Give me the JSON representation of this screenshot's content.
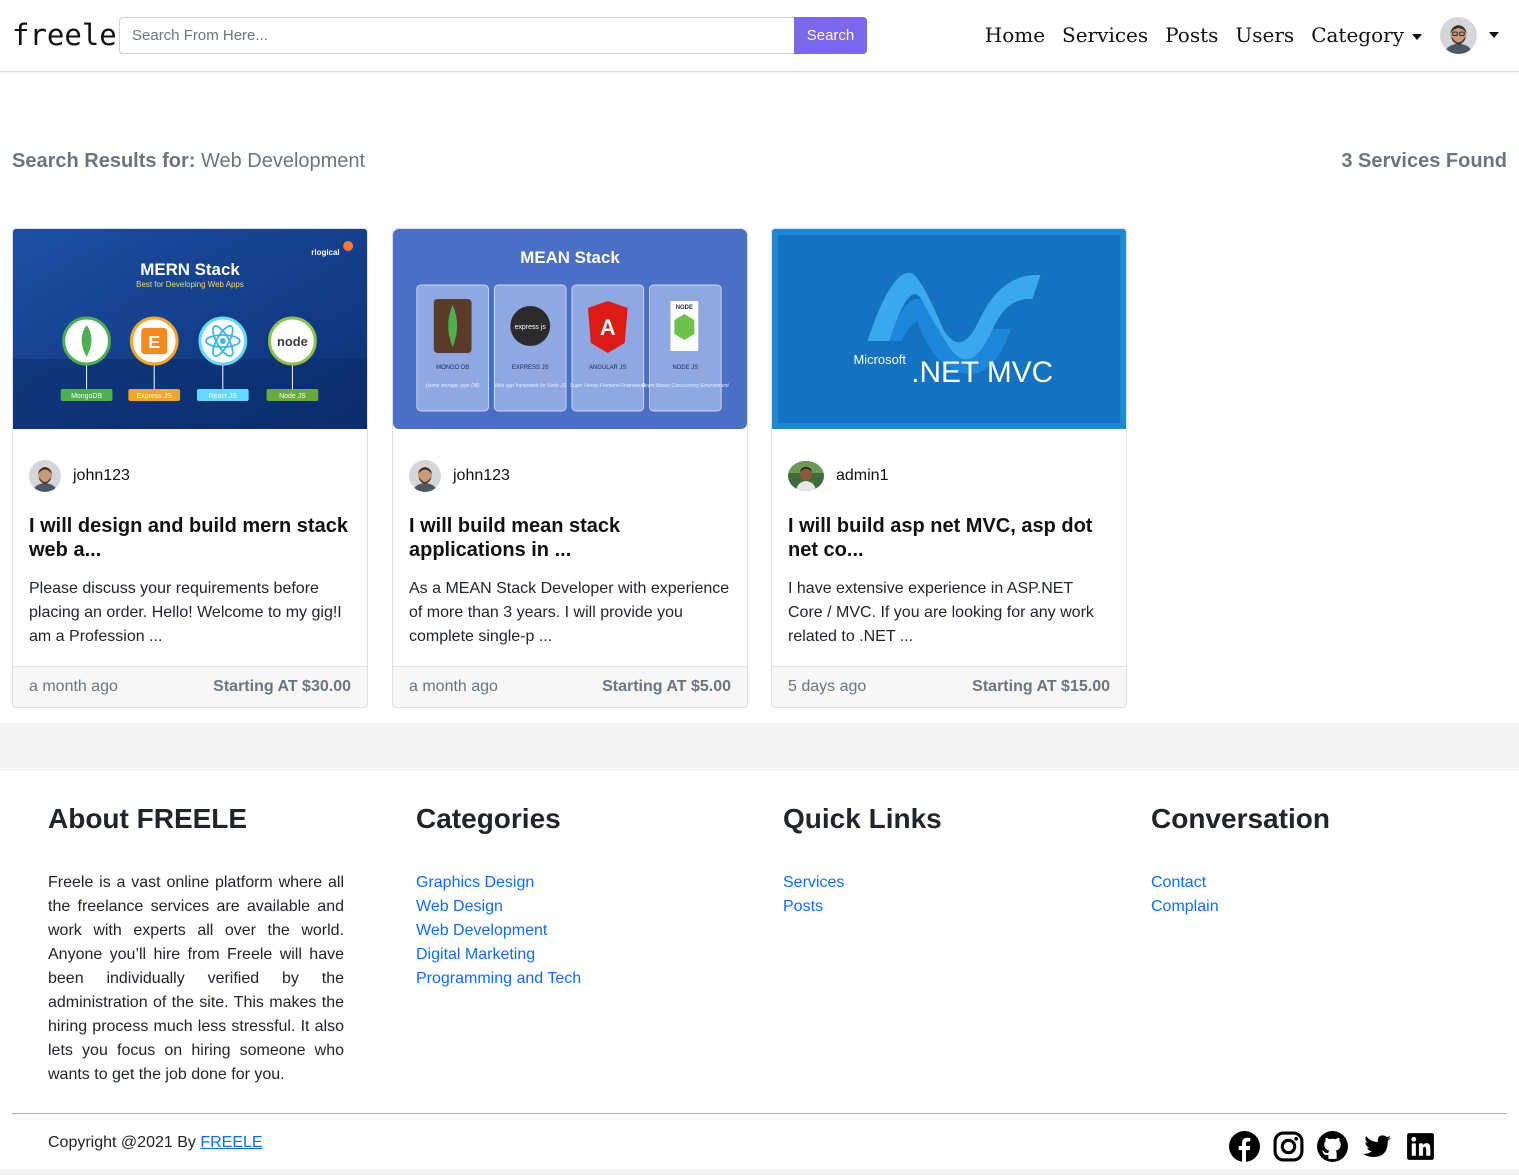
{
  "navbar": {
    "brand": "freele",
    "search": {
      "placeholder": "Search From Here...",
      "value": "",
      "button_label": "Search"
    },
    "links": [
      "Home",
      "Services",
      "Posts",
      "Users"
    ],
    "category_label": "Category"
  },
  "results": {
    "label": "Search Results for:",
    "query": "Web Development",
    "count_text": "3 Services Found"
  },
  "cards": [
    {
      "image": {
        "heading": "MERN Stack",
        "subheading": "Best for Developing Web Apps",
        "brand": "rlogical",
        "tags": [
          "MongoDB",
          "Express JS",
          "React JS",
          "Node JS"
        ]
      },
      "user": "john123",
      "title": "I will design and build mern stack web a...",
      "description": "Please discuss your requirements before placing an order. Hello! Welcome to my gig!I am a Profession ...",
      "time": "a month ago",
      "price": "Starting AT $30.00"
    },
    {
      "image": {
        "heading": "MEAN Stack",
        "tags": [
          "MONGO DB",
          "EXPRESS JS",
          "ANGULAR JS",
          "NODE JS"
        ],
        "logo_text": [
          "express js",
          "NODE"
        ],
        "tag_notes": [
          "(some storage, type DB)",
          "Web app framework for Node JS",
          "Super Heroic Frontend Framework",
          "Event Based Concurrency Environment"
        ]
      },
      "user": "john123",
      "title": "I will build mean stack applications in ...",
      "description": "As a MEAN Stack Developer with experience of more than 3 years. I will provide you complete single-p ...",
      "time": "a month ago",
      "price": "Starting AT $5.00"
    },
    {
      "image": {
        "brand_small": "Microsoft",
        "brand_big": ".NET MVC"
      },
      "user": "admin1",
      "title": "I will build asp net MVC, asp dot net co...",
      "description": "I have extensive experience in  ASP.NET Core / MVC. If you are looking for any work related to .NET ...",
      "time": "5 days ago",
      "price": "Starting AT $15.00"
    }
  ],
  "footer": {
    "about": {
      "title": "About FREELE",
      "text": "Freele is a vast online platform where all the freelance services are available and work with experts all over the world. Anyone you’ll hire from Freele will have been individually verified by the administration of the site. This makes the hiring process much less stressful. It also lets you focus on hiring someone who wants to get the job done for you."
    },
    "categories": {
      "title": "Categories",
      "links": [
        "Graphics Design",
        "Web Design",
        "Web Development",
        "Digital Marketing",
        "Programming and Tech"
      ]
    },
    "quick_links": {
      "title": "Quick Links",
      "links": [
        "Services",
        "Posts"
      ]
    },
    "conversation": {
      "title": "Conversation",
      "links": [
        "Contact",
        "Complain"
      ]
    },
    "copyright_prefix": "Copyright @2021 By",
    "copyright_link": "FREELE",
    "socials": [
      "facebook-icon",
      "instagram-icon",
      "github-icon",
      "twitter-icon",
      "linkedin-icon"
    ]
  },
  "colors": {
    "accent": "#7b68ee",
    "link": "#0d6efd",
    "muted": "#6c757d"
  }
}
